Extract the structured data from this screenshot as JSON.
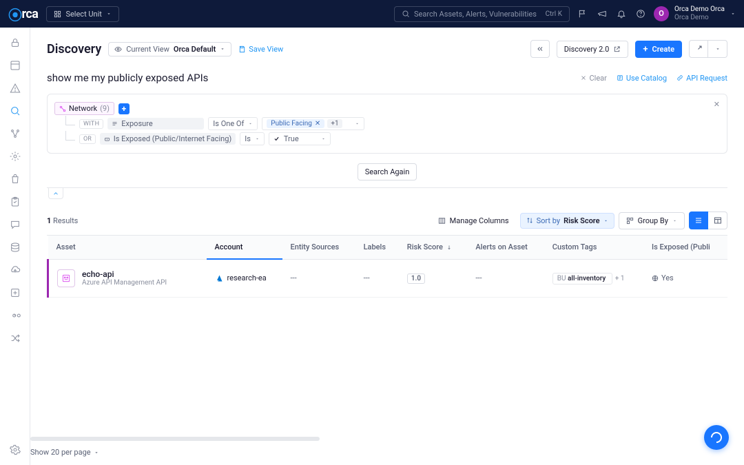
{
  "topnav": {
    "unit_label": "Select Unit",
    "search_placeholder": "Search Assets, Alerts, Vulnerabilities",
    "search_kbd": "Ctrl K",
    "user_line1": "Orca Demo Orca",
    "user_line2": "Orca Demo",
    "avatar_letter": "O"
  },
  "page": {
    "title": "Discovery",
    "view_label": "Current View",
    "view_name": "Orca Default",
    "save_view": "Save View",
    "discovery2": "Discovery 2.0",
    "create": "Create"
  },
  "query": {
    "text": "show me my publicly exposed APIs",
    "clear": "Clear",
    "use_catalog": "Use Catalog",
    "api_request": "API Request"
  },
  "filters": {
    "entity": "Network",
    "entity_count": "(9)",
    "with": "WITH",
    "field1": "Exposure",
    "op1": "Is One Of",
    "val1a": "Public Facing",
    "val1b": "+1",
    "or": "OR",
    "field2": "Is Exposed (Public/Internet Facing)",
    "op2": "Is",
    "val2": "True"
  },
  "search_again": "Search Again",
  "toolbar": {
    "results_n": "1",
    "results_label": "Results",
    "manage_cols": "Manage Columns",
    "sort_label": "Sort by",
    "sort_value": "Risk Score",
    "group_by": "Group By"
  },
  "columns": [
    "Asset",
    "Account",
    "Entity Sources",
    "Labels",
    "Risk Score",
    "Alerts on Asset",
    "Custom Tags",
    "Is Exposed (Publi"
  ],
  "row": {
    "asset_name": "echo-api",
    "asset_sub": "Azure API Management API",
    "account": "research-ea",
    "entity_sources": "---",
    "labels": "---",
    "risk_score": "1.0",
    "alerts": "---",
    "tag_key": "BU",
    "tag_val": "all-inventory",
    "tag_more": "+ 1",
    "exposed": "Yes"
  },
  "pager": {
    "label": "Show 20 per page"
  }
}
